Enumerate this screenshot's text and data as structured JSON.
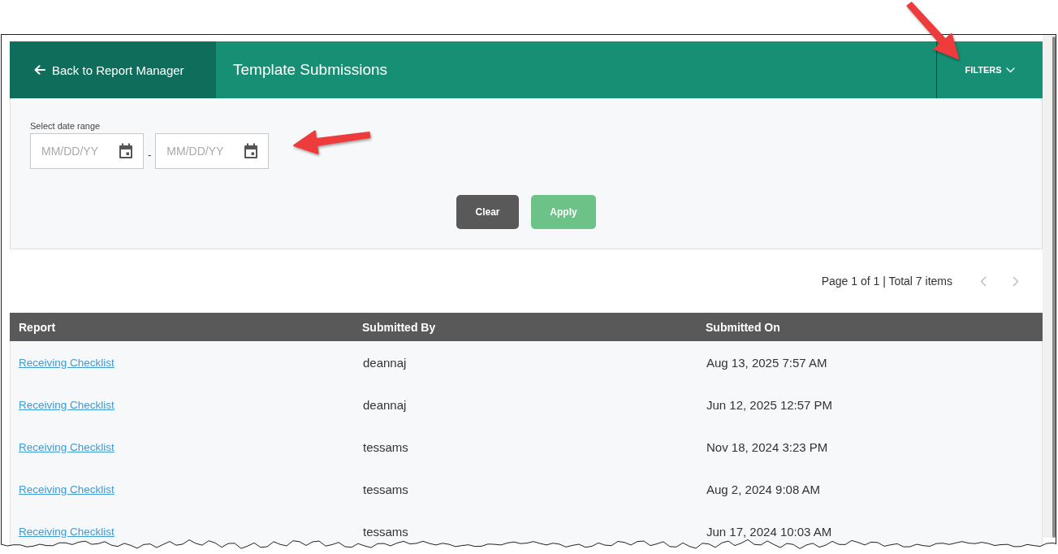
{
  "header": {
    "back_link": "Back to Report Manager",
    "title": "Template Submissions",
    "filters_button": {
      "label": "FILTERS",
      "expanded": true,
      "annotation_arrow": true
    }
  },
  "filters": {
    "label": "Select date range",
    "date_range": {
      "start": {
        "placeholder": "MM/DD/YY"
      },
      "separator": "-",
      "end": {
        "placeholder": "MM/DD/YY"
      },
      "annotation_arrow": true
    },
    "buttons": [
      {
        "label": "Clear",
        "kind": "secondary"
      },
      {
        "label": "Apply",
        "kind": "primary"
      }
    ]
  },
  "pagination": {
    "summary": "Page 1 of 1 | Total 7 items",
    "previous": {
      "disabled": true
    },
    "next": {
      "disabled": true
    }
  },
  "table": {
    "columns": [
      "Report",
      "Submitted By",
      "Submitted On"
    ],
    "rows": [
      {
        "report": "Receiving Checklist",
        "submitted_by": "deannaj",
        "submitted_on": "Aug 13, 2025 7:57 AM"
      },
      {
        "report": "Receiving Checklist",
        "submitted_by": "deannaj",
        "submitted_on": "Jun 12, 2025 12:57 PM"
      },
      {
        "report": "Receiving Checklist",
        "submitted_by": "tessams",
        "submitted_on": "Nov 18, 2024 3:23 PM"
      },
      {
        "report": "Receiving Checklist",
        "submitted_by": "tessams",
        "submitted_on": "Aug 2, 2024 9:08 AM"
      },
      {
        "report": "Receiving Checklist",
        "submitted_by": "tessams",
        "submitted_on": "Jun 17, 2024 10:03 AM"
      }
    ]
  }
}
